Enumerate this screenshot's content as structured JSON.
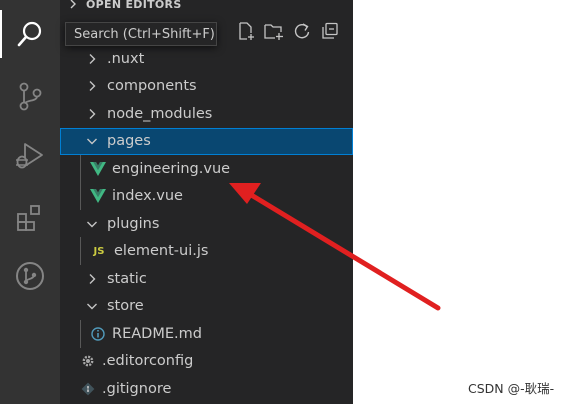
{
  "explorer": {
    "section_title": "OPEN EDITORS",
    "tooltip": "Search (Ctrl+Shift+F)"
  },
  "activity_bar": {
    "items": [
      "search-icon",
      "source-control-icon",
      "run-debug-icon",
      "extensions-icon",
      "git-graph-icon"
    ]
  },
  "tree": {
    "nuxt": ".nuxt",
    "components": "components",
    "node_modules": "node_modules",
    "pages": "pages",
    "engineering": "engineering.vue",
    "index": "index.vue",
    "plugins": "plugins",
    "element_ui": "element-ui.js",
    "js_badge": "JS",
    "static": "static",
    "store": "store",
    "readme": "README.md",
    "editorconfig": ".editorconfig",
    "gitignore": ".gitignore"
  },
  "colors": {
    "selection": "#094771",
    "vue_green": "#41b883",
    "js_yellow": "#cbcb41",
    "arrow_red": "#e02020"
  },
  "watermark": "CSDN @-耿瑞-"
}
